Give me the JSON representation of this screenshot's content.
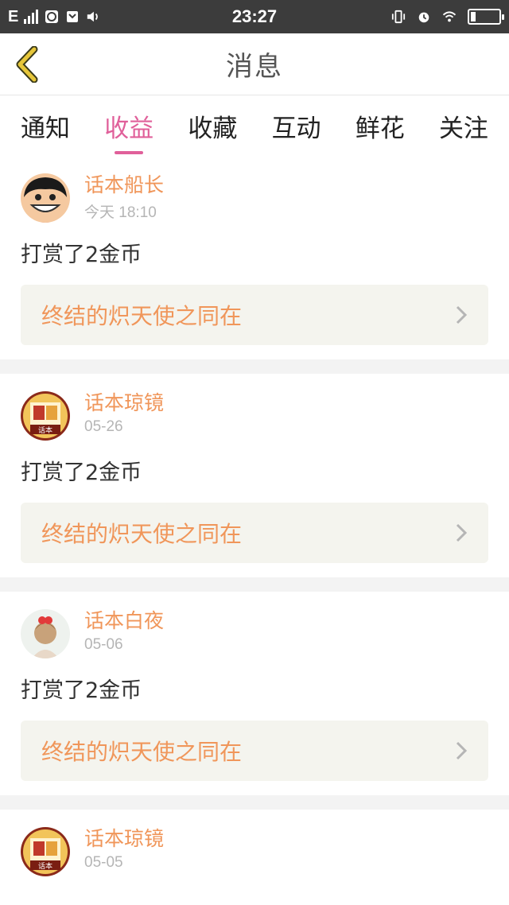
{
  "statusbar": {
    "carrier": "E",
    "time": "23:27"
  },
  "header": {
    "title": "消息"
  },
  "tabs": [
    {
      "label": "通知",
      "active": false
    },
    {
      "label": "收益",
      "active": true
    },
    {
      "label": "收藏",
      "active": false
    },
    {
      "label": "互动",
      "active": false
    },
    {
      "label": "鲜花",
      "active": false
    },
    {
      "label": "关注",
      "active": false
    }
  ],
  "items": [
    {
      "user": "话本船长",
      "time": "今天 18:10",
      "action": "打赏了2金币",
      "link": "终结的炽天使之同在"
    },
    {
      "user": "话本琼镜",
      "time": "05-26",
      "action": "打赏了2金币",
      "link": "终结的炽天使之同在"
    },
    {
      "user": "话本白夜",
      "time": "05-06",
      "action": "打赏了2金币",
      "link": "终结的炽天使之同在"
    },
    {
      "user": "话本琼镜",
      "time": "05-05"
    }
  ],
  "colors": {
    "accent": "#e0609a",
    "name": "#f0965a",
    "back": "#e6c63a"
  }
}
